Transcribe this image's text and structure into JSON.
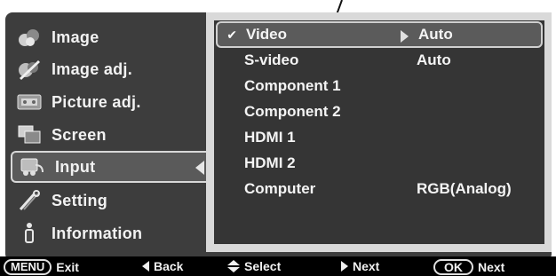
{
  "sidebar": {
    "items": [
      {
        "label": "Image",
        "icon": "image-icon"
      },
      {
        "label": "Image adj.",
        "icon": "image-adj-icon"
      },
      {
        "label": "Picture adj.",
        "icon": "picture-adj-icon"
      },
      {
        "label": "Screen",
        "icon": "screen-icon"
      },
      {
        "label": "Input",
        "icon": "input-icon",
        "active": true
      },
      {
        "label": "Setting",
        "icon": "setting-icon"
      },
      {
        "label": "Information",
        "icon": "information-icon"
      }
    ]
  },
  "submenu": {
    "rows": [
      {
        "label": "Video",
        "value": "Auto",
        "selected": true,
        "check": "✔"
      },
      {
        "label": "S-video",
        "value": "Auto"
      },
      {
        "label": "Component 1",
        "value": ""
      },
      {
        "label": "Component 2",
        "value": ""
      },
      {
        "label": "HDMI 1",
        "value": ""
      },
      {
        "label": "HDMI 2",
        "value": ""
      },
      {
        "label": "Computer",
        "value": "RGB(Analog)"
      }
    ]
  },
  "bottom_bar": {
    "menu_key": "MENU",
    "exit": "Exit",
    "back": "Back",
    "select": "Select",
    "next": "Next",
    "ok_key": "OK",
    "ok_next": "Next"
  },
  "colors": {
    "panel_bg": "#353535",
    "frame_bg": "#3d3d3d",
    "highlight": "#5b5b5b",
    "border": "#d9d9d9"
  }
}
